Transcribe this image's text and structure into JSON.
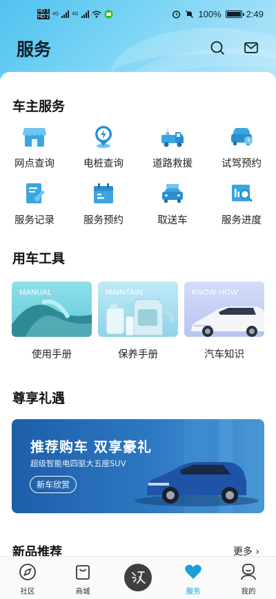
{
  "status_bar": {
    "time": "2:49",
    "battery": "100%",
    "network": [
      "4G",
      "4G"
    ]
  },
  "header": {
    "title": "服务",
    "search_icon": "search-icon",
    "mail_icon": "mail-icon"
  },
  "owner_services": {
    "title": "车主服务",
    "items": [
      {
        "label": "网点查询",
        "icon": "store-icon"
      },
      {
        "label": "电桩查询",
        "icon": "charging-pin-icon"
      },
      {
        "label": "道路救援",
        "icon": "tow-truck-icon"
      },
      {
        "label": "试驾预约",
        "icon": "test-drive-car-icon"
      },
      {
        "label": "服务记录",
        "icon": "service-record-icon"
      },
      {
        "label": "服务预约",
        "icon": "calendar-icon"
      },
      {
        "label": "取送车",
        "icon": "pickup-car-icon"
      },
      {
        "label": "服务进度",
        "icon": "progress-search-icon"
      }
    ]
  },
  "car_tools": {
    "title": "用车工具",
    "cards": [
      {
        "label": "使用手册",
        "eng": "MANUAL"
      },
      {
        "label": "保养手册",
        "eng": "MAINTAIN"
      },
      {
        "label": "汽车知识",
        "eng": "KNOW-HOW"
      }
    ]
  },
  "perks": {
    "title": "尊享礼遇",
    "banner": {
      "title": "推荐购车 双享豪礼",
      "subtitle": "超级智能电四驱大五座SUV",
      "button": "新车欣赏"
    }
  },
  "new_products": {
    "title": "新品推荐",
    "more": "更多"
  },
  "tabbar": {
    "tabs": [
      {
        "label": "社区",
        "icon": "compass-icon"
      },
      {
        "label": "商城",
        "icon": "shopping-bag-icon"
      },
      {
        "label": "",
        "icon": "brand-logo-icon"
      },
      {
        "label": "服务",
        "icon": "heart-icon"
      },
      {
        "label": "我的",
        "icon": "profile-icon"
      }
    ],
    "active": "服务"
  },
  "colors": {
    "accent": "#1a9fd8",
    "icon_blue": "#2a8fd0",
    "icon_light": "#6fc6ee",
    "banner_blue": "#1d5ea9"
  }
}
